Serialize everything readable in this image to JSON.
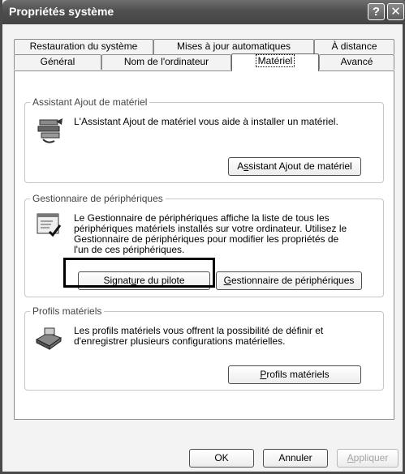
{
  "window": {
    "title": "Propriétés système",
    "help_glyph": "?",
    "close_glyph": "✕"
  },
  "tabs": {
    "row1": [
      "Restauration du système",
      "Mises à jour automatiques",
      "À distance"
    ],
    "row2": [
      "Général",
      "Nom de l'ordinateur",
      "Matériel",
      "Avancé"
    ],
    "active": "Matériel"
  },
  "wizard": {
    "group_label": "Assistant Ajout de matériel",
    "description": "L'Assistant Ajout de matériel vous aide à installer un matériel.",
    "button_pre": "A",
    "button_u": "s",
    "button_post": "sistant Ajout de matériel",
    "icon": "hardware-wizard-icon"
  },
  "device_manager": {
    "group_label": "Gestionnaire de périphériques",
    "desc_lines": [
      "Le Gestionnaire de périphériques affiche la liste de tous les",
      "périphériques matériels installés sur votre ordinateur. Utilisez le",
      "Gestionnaire de périphériques pour modifier les propriétés de",
      "l'un de ces périphériques."
    ],
    "signature_pre": "Signat",
    "signature_u": "u",
    "signature_post": "re du pilote",
    "manager_u": "G",
    "manager_post": "estionnaire de périphériques",
    "icon": "device-manager-icon"
  },
  "profiles": {
    "group_label": "Profils matériels",
    "desc_lines": [
      "Les profils matériels vous offrent la possibilité de définir et",
      "d'enregistrer plusieurs configurations matérielles."
    ],
    "button_u": "P",
    "button_post": "rofils matériels",
    "icon": "hardware-profiles-icon"
  },
  "footer": {
    "ok_label": "OK",
    "cancel_label": "Annuler",
    "apply_pre": "",
    "apply_u": "A",
    "apply_post": "ppliquer"
  }
}
